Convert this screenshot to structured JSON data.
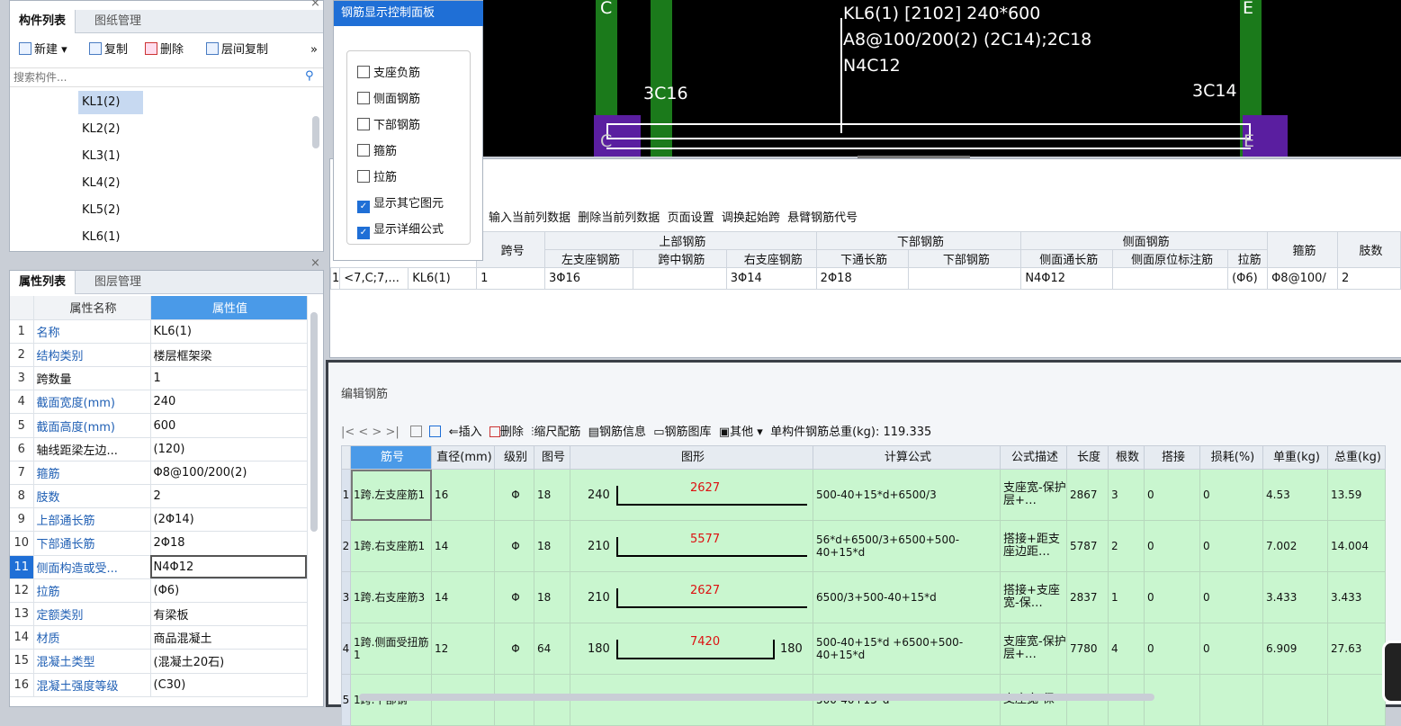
{
  "component_panel": {
    "tabs": [
      "构件列表",
      "图纸管理"
    ],
    "toolbar": {
      "new": "新建",
      "copy": "复制",
      "delete": "删除",
      "floor_copy": "层间复制",
      "more": "»"
    },
    "search_placeholder": "搜索构件...",
    "items": [
      "KL1(2)",
      "KL2(2)",
      "KL3(1)",
      "KL4(2)",
      "KL5(2)",
      "KL6(1)"
    ]
  },
  "prop_panel": {
    "tabs": [
      "属性列表",
      "图层管理"
    ],
    "col_name": "属性名称",
    "col_value": "属性值",
    "rows": [
      {
        "n": "1",
        "name": "名称",
        "value": "KL6(1)"
      },
      {
        "n": "2",
        "name": "结构类别",
        "value": "楼层框架梁"
      },
      {
        "n": "3",
        "name": "跨数量",
        "value": "1"
      },
      {
        "n": "4",
        "name": "截面宽度(mm)",
        "value": "240"
      },
      {
        "n": "5",
        "name": "截面高度(mm)",
        "value": "600"
      },
      {
        "n": "6",
        "name": "轴线距梁左边...",
        "value": "(120)"
      },
      {
        "n": "7",
        "name": "箍筋",
        "value": "Φ8@100/200(2)"
      },
      {
        "n": "8",
        "name": "肢数",
        "value": "2"
      },
      {
        "n": "9",
        "name": "上部通长筋",
        "value": "(2Φ14)"
      },
      {
        "n": "10",
        "name": "下部通长筋",
        "value": "2Φ18"
      },
      {
        "n": "11",
        "name": "侧面构造或受...",
        "value": "N4Φ12"
      },
      {
        "n": "12",
        "name": "拉筋",
        "value": "(Φ6)"
      },
      {
        "n": "13",
        "name": "定额类别",
        "value": "有梁板"
      },
      {
        "n": "14",
        "name": "材质",
        "value": "商品混凝土"
      },
      {
        "n": "15",
        "name": "混凝土类型",
        "value": "(混凝土20石)"
      },
      {
        "n": "16",
        "name": "混凝土强度等级",
        "value": "(C30)"
      }
    ]
  },
  "control_panel": {
    "title": "钢筋显示控制面板",
    "options": [
      {
        "label": "支座负筋",
        "checked": false
      },
      {
        "label": "侧面钢筋",
        "checked": false
      },
      {
        "label": "下部钢筋",
        "checked": false
      },
      {
        "label": "箍筋",
        "checked": false
      },
      {
        "label": "拉筋",
        "checked": false
      },
      {
        "label": "显示其它图元",
        "checked": true
      },
      {
        "label": "显示详细公式",
        "checked": true
      }
    ]
  },
  "cad": {
    "axis_c": "C",
    "axis_e": "E",
    "axis_c2": "C",
    "axis_e2": "E",
    "label1": "KL6(1) [2102] 240*600",
    "label2": "A8@100/200(2) (2C14);2C18",
    "label3": "N4C12",
    "left_top": "3C16",
    "right_top": "3C14"
  },
  "beam_table": {
    "menu": [
      "输入当前列数据",
      "删除当前列数据",
      "页面设置",
      "调换起始跨",
      "悬臂钢筋代号"
    ],
    "groups": {
      "span": "跨号",
      "top": "上部钢筋",
      "bottom": "下部钢筋",
      "side": "侧面钢筋",
      "stirrup": "箍筋",
      "legs": "肢数"
    },
    "sub": [
      "左支座钢筋",
      "跨中钢筋",
      "右支座钢筋",
      "下通长筋",
      "下部钢筋",
      "侧面通长筋",
      "侧面原位标注筋",
      "拉筋"
    ],
    "row": [
      "1",
      "<7,C;7,...",
      "KL6(1)",
      "1",
      "3Φ16",
      "",
      "3Φ14",
      "2Φ18",
      "",
      "N4Φ12",
      "",
      "(Φ6)",
      "Φ8@100/",
      "2"
    ]
  },
  "edit_panel": {
    "title": "编辑钢筋",
    "nav": "|<  <  >  >|",
    "tools": {
      "insert": "插入",
      "delete": "删除",
      "scale": "缩尺配筋",
      "info": "钢筋信息",
      "lib": "钢筋图库",
      "other": "其他"
    },
    "total_label": "单构件钢筋总重(kg): 119.335",
    "headers": [
      "筋号",
      "直径(mm)",
      "级别",
      "图号",
      "图形",
      "计算公式",
      "公式描述",
      "长度",
      "根数",
      "搭接",
      "损耗(%)",
      "单重(kg)",
      "总重(kg)"
    ],
    "rows": [
      {
        "n": "1",
        "name": "1跨.左支座筋1",
        "dia": "16",
        "grade": "Φ",
        "fig": "18",
        "s_left": "240",
        "s_mid": "2627",
        "s_right": "",
        "formula": "500-40+15*d+6500/3",
        "desc": "支座宽-保护层+…",
        "len": "2867",
        "cnt": "3",
        "lap": "0",
        "loss": "0",
        "unit": "4.53",
        "total": "13.59"
      },
      {
        "n": "2",
        "name": "1跨.右支座筋1",
        "dia": "14",
        "grade": "Φ",
        "fig": "18",
        "s_left": "210",
        "s_mid": "5577",
        "s_right": "",
        "formula": "56*d+6500/3+6500+500-40+15*d",
        "desc": "搭接+距支座边距…",
        "len": "5787",
        "cnt": "2",
        "lap": "0",
        "loss": "0",
        "unit": "7.002",
        "total": "14.004"
      },
      {
        "n": "3",
        "name": "1跨.右支座筋3",
        "dia": "14",
        "grade": "Φ",
        "fig": "18",
        "s_left": "210",
        "s_mid": "2627",
        "s_right": "",
        "formula": "6500/3+500-40+15*d",
        "desc": "搭接+支座宽-保…",
        "len": "2837",
        "cnt": "1",
        "lap": "0",
        "loss": "0",
        "unit": "3.433",
        "total": "3.433"
      },
      {
        "n": "4",
        "name": "1跨.侧面受扭筋1",
        "dia": "12",
        "grade": "Φ",
        "fig": "64",
        "s_left": "180",
        "s_mid": "7420",
        "s_right": "180",
        "formula": "500-40+15*d +6500+500-40+15*d",
        "desc": "支座宽-保护层+…",
        "len": "7780",
        "cnt": "4",
        "lap": "0",
        "loss": "0",
        "unit": "6.909",
        "total": "27.63"
      },
      {
        "n": "5",
        "name": "1跨.下部钢",
        "dia": "",
        "grade": "",
        "fig": "",
        "s_left": "",
        "s_mid": "",
        "s_right": "",
        "formula": "500-40+15*d",
        "desc": "支座宽-保",
        "len": "",
        "cnt": "",
        "lap": "",
        "loss": "",
        "unit": "",
        "total": ""
      }
    ]
  },
  "colors": {
    "accent": "#1f6fd6",
    "row_green": "#c9f6cf",
    "cad_green": "#1b7a1b",
    "cad_purple": "#5a1ea0"
  }
}
